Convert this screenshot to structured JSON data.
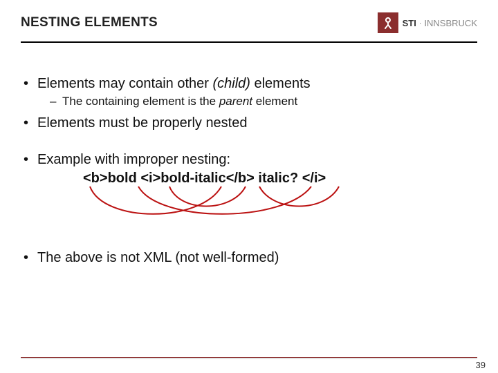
{
  "header": {
    "title": "NESTING ELEMENTS",
    "logo": {
      "mark": "⇕",
      "brand_bold": "STI",
      "dot": " · ",
      "brand_light": "INNSBRUCK"
    }
  },
  "body": {
    "b1": "Elements may contain other ",
    "b1_italic": "(child)",
    "b1_tail": " elements",
    "b1_sub_a": "The containing element is the ",
    "b1_sub_italic": "parent",
    "b1_sub_tail": " element",
    "b2": "Elements must be properly nested",
    "b3": "Example with improper nesting:",
    "b3_code": "<b>bold <i>bold-italic</b> italic? </i>",
    "b4": "The above is not XML (not well-formed)"
  },
  "footer": {
    "page": "39"
  }
}
